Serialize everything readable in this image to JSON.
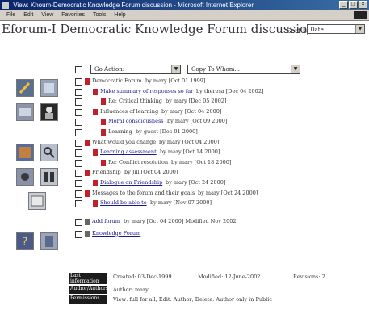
{
  "window": {
    "title": "View: Khoum-Democratic Knowledge Forum discussion - Microsoft Internet Explorer",
    "controls": [
      "_",
      "□",
      "×"
    ]
  },
  "menubar": {
    "items": [
      "File",
      "Edit",
      "View",
      "Favorites",
      "Tools",
      "Help"
    ]
  },
  "header": {
    "title": "Eforum-I Democratic Knowledge Forum discussion",
    "sort_label": "Sort by:",
    "sort_value": "Date"
  },
  "toolbar": {
    "action_select": "Go Action:",
    "copy_select": "Copy To Whom..."
  },
  "tree": [
    {
      "level": 0,
      "title": "Democratic Forum",
      "meta": "by mary [Oct 01 1999]",
      "link": false
    },
    {
      "level": 1,
      "title": "Make summary of responses so far",
      "meta": "by theresa [Dec 04 2002]",
      "link": true
    },
    {
      "level": 2,
      "title": "Re: Critical thinking",
      "meta": "by mary [Dec 05 2002]",
      "link": false
    },
    {
      "level": 1,
      "title": "Influences of learning",
      "meta": "by mary [Oct 04 2000]",
      "link": false
    },
    {
      "level": 2,
      "title": "Moral consciousness",
      "meta": "by mary [Oct 09 2000]",
      "link": true
    },
    {
      "level": 2,
      "title": "Learning",
      "meta": "by guest [Dec 01 2000]",
      "link": false
    },
    {
      "level": 0,
      "title": "What would you change",
      "meta": "by mary [Oct 04 2000]",
      "link": false
    },
    {
      "level": 1,
      "title": "Learning assessment",
      "meta": "by mary [Oct 14 2000]",
      "link": true
    },
    {
      "level": 2,
      "title": "Re: Conflict resolution",
      "meta": "by mary [Oct 18 2000]",
      "link": false
    },
    {
      "level": 0,
      "title": "Friendship",
      "meta": "by Jill [Oct 04 2000]",
      "link": false
    },
    {
      "level": 1,
      "title": "Dialogue on Friendship",
      "meta": "by mary [Oct 24 2000]",
      "link": true
    },
    {
      "level": 0,
      "title": "Messages to the forum and their goals",
      "meta": "by mary [Oct 24 2000]",
      "link": false
    },
    {
      "level": 1,
      "title": "Should be able to",
      "meta": "by mary [Nov 07 2000]",
      "link": true
    }
  ],
  "extras": [
    {
      "title": "Add forum",
      "meta": "by mary [Oct 04 2000] Modified Nov 2002",
      "link": true
    },
    {
      "title": "Knowledge Forum",
      "meta": "",
      "link": true
    }
  ],
  "footer": {
    "rows": [
      {
        "label": "Last information",
        "cols": [
          "Created: 03-Dec-1999",
          "Modified: 12-June-2002",
          "Revisions: 2"
        ]
      },
      {
        "label": "Author/Authors",
        "cols": [
          "Author: mary"
        ]
      },
      {
        "label": "Permissions",
        "cols": [
          "View: full for all; Edit: Author; Delete: Author only in Public"
        ]
      }
    ]
  },
  "colors": {
    "titlebar": "#0a246a",
    "doc_icon": "#c0202a",
    "link": "#1a1a8a"
  }
}
